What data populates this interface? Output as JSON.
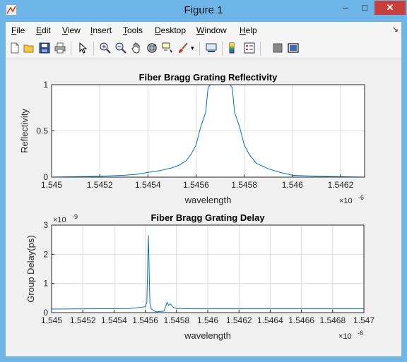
{
  "window": {
    "title": "Figure 1",
    "minimize_icon": "minimize-icon",
    "maximize_icon": "maximize-icon",
    "close_icon": "close-icon"
  },
  "menu": [
    {
      "label": "File",
      "key": "F"
    },
    {
      "label": "Edit",
      "key": "E"
    },
    {
      "label": "View",
      "key": "V"
    },
    {
      "label": "Insert",
      "key": "I"
    },
    {
      "label": "Tools",
      "key": "T"
    },
    {
      "label": "Desktop",
      "key": "D"
    },
    {
      "label": "Window",
      "key": "W"
    },
    {
      "label": "Help",
      "key": "H"
    }
  ],
  "toolbar": [
    "new-figure-icon",
    "open-file-icon",
    "save-icon",
    "print-icon",
    "pointer-icon",
    "zoom-in-icon",
    "zoom-out-icon",
    "pan-icon",
    "rotate-icon",
    "data-cursor-icon",
    "brush-icon",
    "link-icon",
    "colorbar-icon",
    "legend-icon",
    "hide-plot-tools-icon",
    "show-plot-tools-icon"
  ],
  "chart_data": [
    {
      "type": "line",
      "title": "Fiber Bragg Grating Reflectivity",
      "xlabel": "wavelength",
      "ylabel": "Reflectivity",
      "x_exponent": "×10",
      "x_exponent_power": "-6",
      "xlim": [
        1.545,
        1.5463
      ],
      "ylim": [
        0,
        1
      ],
      "xticks": [
        "1.545",
        "1.5452",
        "1.5454",
        "1.5456",
        "1.5458",
        "1.546",
        "1.5462"
      ],
      "yticks": [
        "0",
        "0.5",
        "1"
      ],
      "grid": true,
      "color": "#0072bd",
      "series": [
        {
          "x": [
            1.545,
            1.5452,
            1.5453,
            1.54535,
            1.5454,
            1.54545,
            1.5455,
            1.54553,
            1.54556,
            1.54558,
            1.5456,
            1.54562,
            1.54564,
            1.54565,
            1.54566,
            1.54567,
            1.54568,
            1.5457,
            1.54572,
            1.54574,
            1.54575,
            1.54576,
            1.54578,
            1.5458,
            1.54582,
            1.54585,
            1.5459,
            1.54595,
            1.546,
            1.5461,
            1.5463
          ],
          "y": [
            0.0,
            0.01,
            0.02,
            0.03,
            0.05,
            0.07,
            0.1,
            0.13,
            0.18,
            0.25,
            0.35,
            0.55,
            0.7,
            0.97,
            1.0,
            1.0,
            1.0,
            1.0,
            1.0,
            1.0,
            0.97,
            0.7,
            0.55,
            0.35,
            0.25,
            0.15,
            0.09,
            0.05,
            0.02,
            0.01,
            0.0
          ]
        }
      ]
    },
    {
      "type": "line",
      "title": "Fiber Bragg Grating Delay",
      "xlabel": "wavelength",
      "ylabel": "Group Delay(ps)",
      "x_exponent": "×10",
      "x_exponent_power": "-6",
      "y_exponent": "×10",
      "y_exponent_power": "-9",
      "xlim": [
        1.545,
        1.547
      ],
      "ylim": [
        0,
        3
      ],
      "xticks": [
        "1.545",
        "1.5452",
        "1.5454",
        "1.5456",
        "1.5458",
        "1.546",
        "1.5462",
        "1.5464",
        "1.5466",
        "1.5468",
        "1.547"
      ],
      "yticks": [
        "0",
        "1",
        "2",
        "3"
      ],
      "grid": true,
      "color": "#0072bd",
      "series": [
        {
          "x": [
            1.545,
            1.5455,
            1.5456,
            1.54561,
            1.54562,
            1.54563,
            1.54564,
            1.54566,
            1.54567,
            1.54568,
            1.5457,
            1.54572,
            1.54574,
            1.54575,
            1.54576,
            1.54578,
            1.5458,
            1.5459,
            1.547
          ],
          "y": [
            0.12,
            0.14,
            0.2,
            0.35,
            2.65,
            0.3,
            0.12,
            0.05,
            0.03,
            0.03,
            0.04,
            0.05,
            0.35,
            0.25,
            0.3,
            0.18,
            0.14,
            0.13,
            0.13
          ]
        }
      ]
    }
  ]
}
